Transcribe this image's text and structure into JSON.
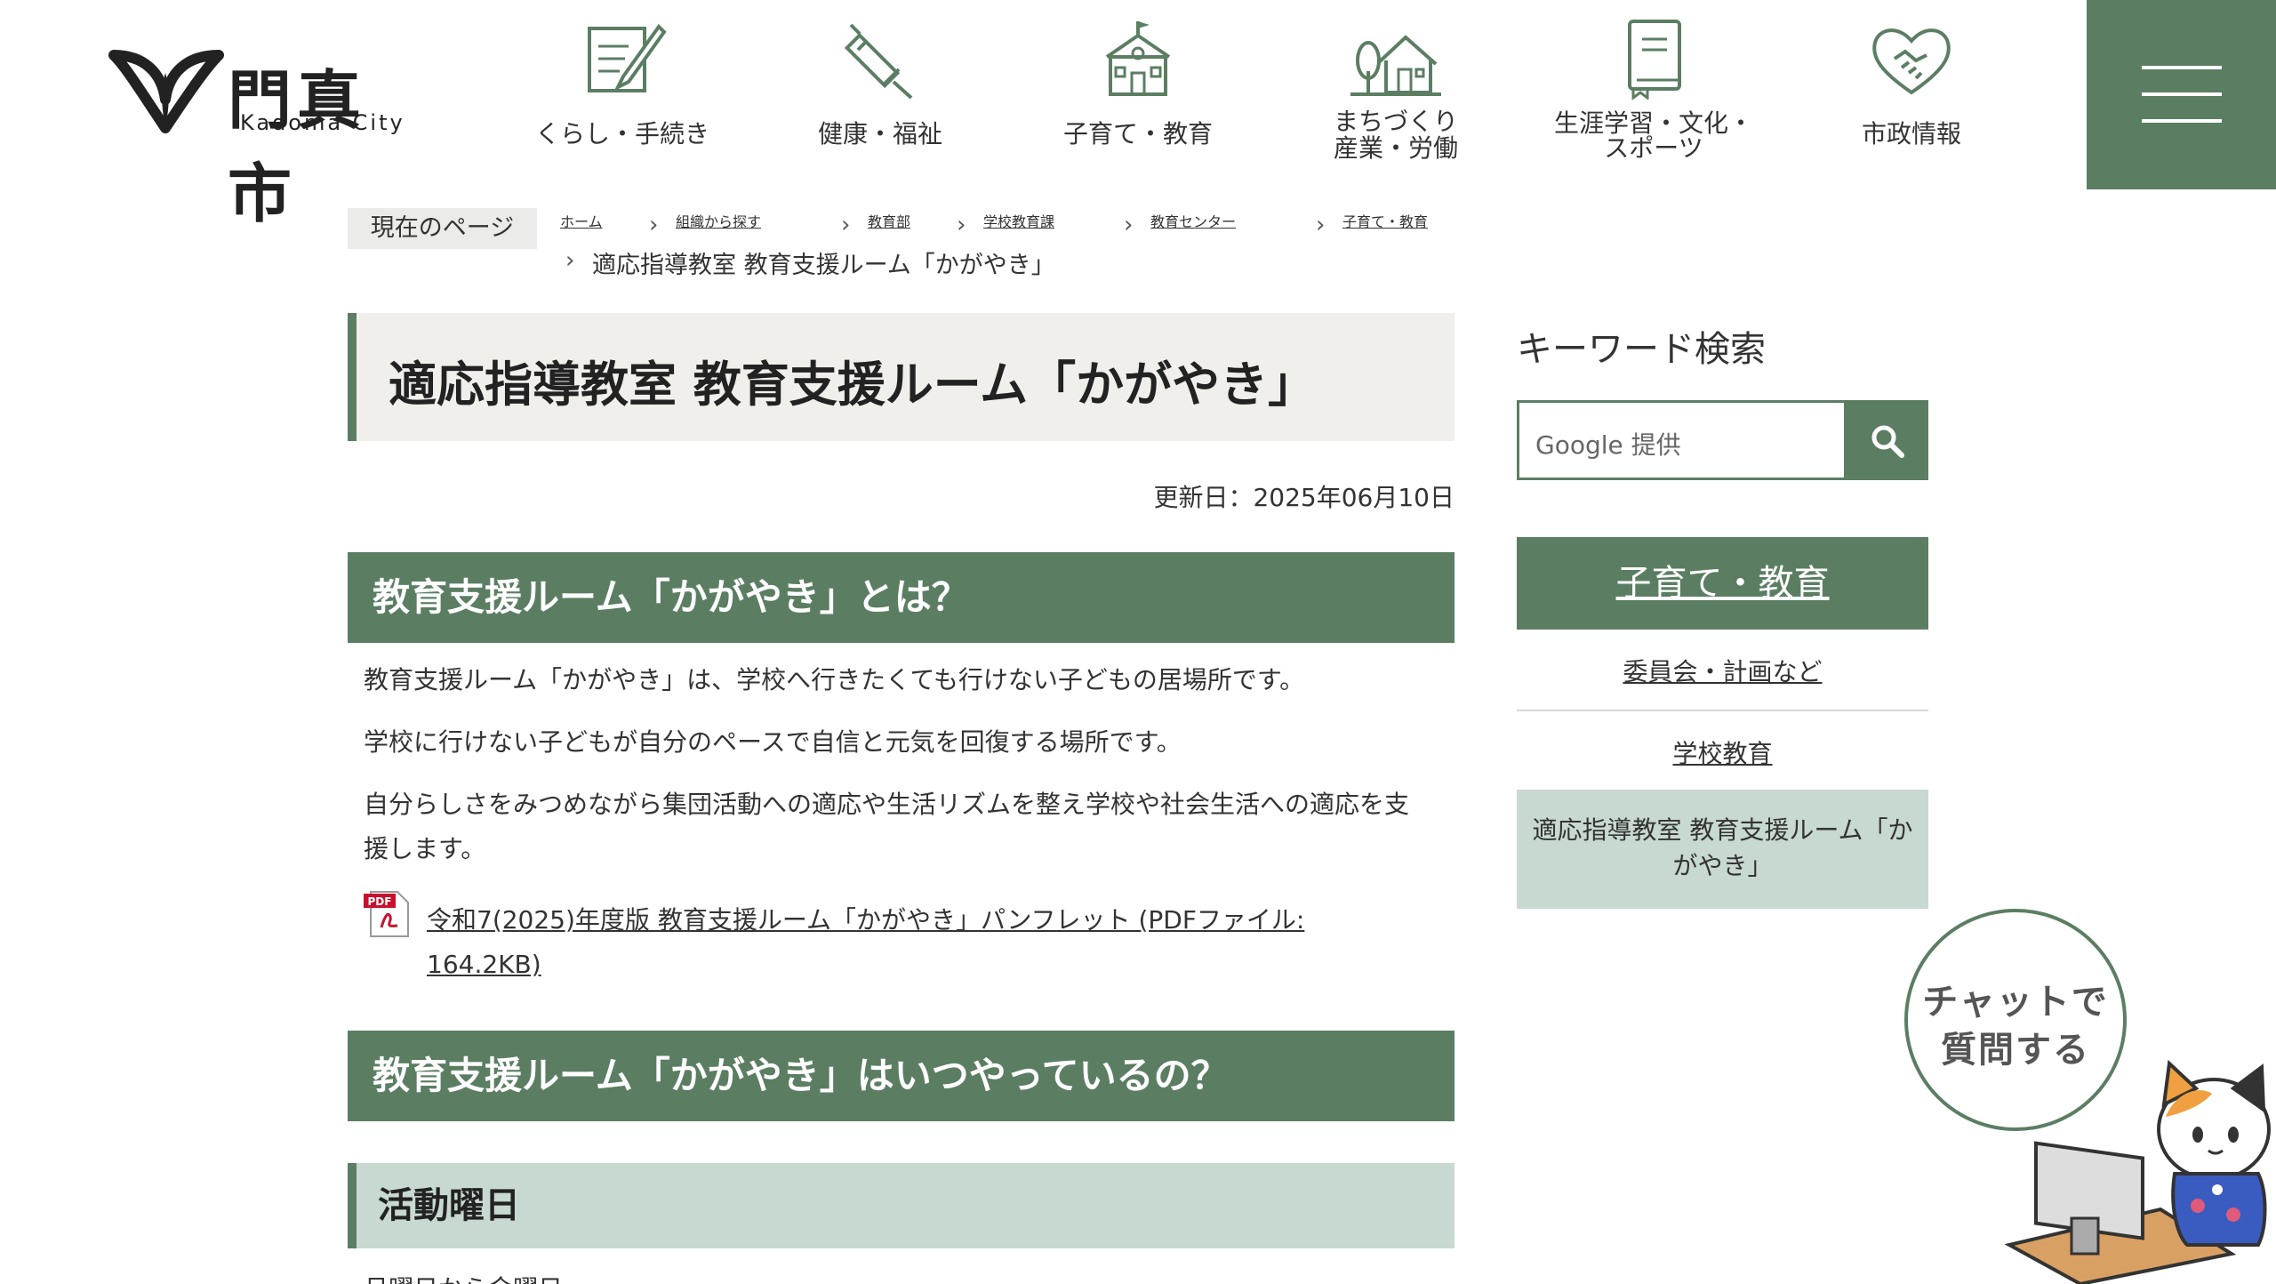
{
  "header": {
    "logo_jp": "門真市",
    "logo_en": "Kadoma City",
    "nav": [
      {
        "label_line1": "くらし・手続き",
        "label_line2": "",
        "icon": "pen-document-icon"
      },
      {
        "label_line1": "健康・福祉",
        "label_line2": "",
        "icon": "syringe-icon"
      },
      {
        "label_line1": "子育て・教育",
        "label_line2": "",
        "icon": "school-icon"
      },
      {
        "label_line1": "まちづくり",
        "label_line2": "産業・労働",
        "icon": "house-tree-icon"
      },
      {
        "label_line1": "生涯学習・文化・",
        "label_line2": "スポーツ",
        "icon": "book-icon"
      },
      {
        "label_line1": "市政情報",
        "label_line2": "",
        "icon": "heart-handshake-icon"
      }
    ],
    "menu_icon": "hamburger-menu-icon"
  },
  "breadcrumb": {
    "tag": "現在のページ",
    "items": [
      "ホーム",
      "組織から探す",
      "教育部",
      "学校教育課",
      "教育センター",
      "子育て・教育"
    ],
    "current": "適応指導教室 教育支援ルーム「かがやき」"
  },
  "main": {
    "title": "適応指導教室 教育支援ルーム「かがやき」",
    "updated": "更新日：2025年06月10日",
    "section1": {
      "heading": "教育支援ルーム「かがやき」とは？",
      "p1": "教育支援ルーム「かがやき」は、学校へ行きたくても行けない子どもの居場所です。",
      "p2": "学校に行けない子どもが自分のペースで自信と元気を回復する場所です。",
      "p3_line1": "自分らしさをみつめながら集団活動への適応や生活リズムを整え学校や社会生活への適応を支",
      "p3_line2": "援します。",
      "pdf_link_line1": "令和7(2025)年度版 教育支援ルーム「かがやき」パンフレット (PDFファイル:",
      "pdf_link_line2": "164.2KB)",
      "pdf_icon": "pdf-file-icon",
      "pdf_icon_label": "PDF"
    },
    "section2": {
      "heading": "教育支援ルーム「かがやき」はいつやっているの？",
      "subheading": "活動曜日",
      "partial_text": "月曜日から金曜日"
    }
  },
  "sidebar": {
    "keyword_title": "キーワード検索",
    "search_placeholder": "Google 提供",
    "search_icon": "search-icon",
    "category": "子育て・教育",
    "items": [
      "委員会・計画など",
      "学校教育"
    ],
    "current_line1": "適応指導教室 教育支援ルーム「か",
    "current_line2": "がやき」"
  },
  "chat": {
    "line1": "チャットで",
    "line2": "質問する",
    "icon": "cat-mascot-icon"
  },
  "colors": {
    "accent_green": "#5b7e63",
    "light_green": "#c7d9d0",
    "title_bg": "#f0efec"
  }
}
